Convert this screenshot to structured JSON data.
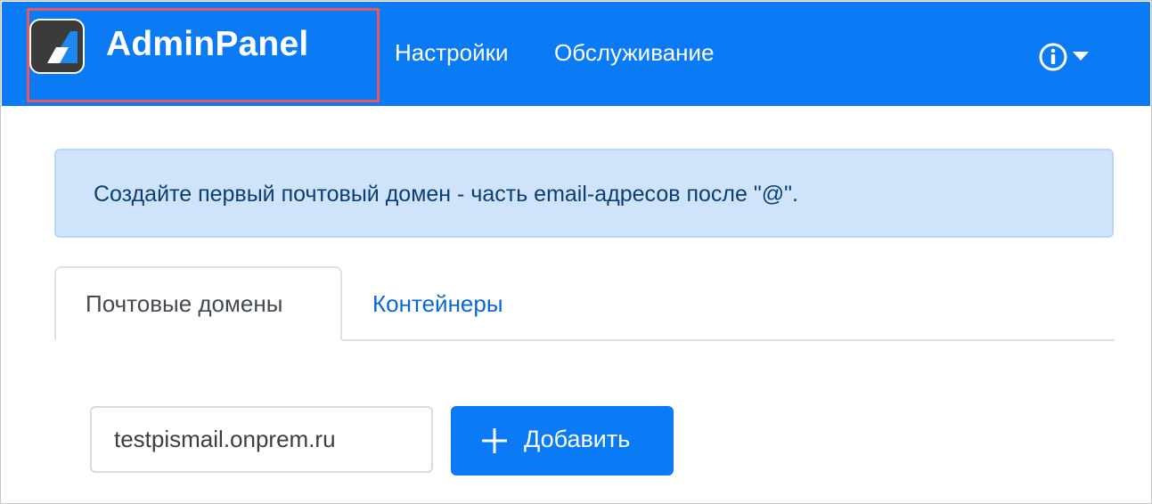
{
  "navbar": {
    "brand": "AdminPanel",
    "links": [
      "Настройки",
      "Обслуживание"
    ],
    "brand_highlight_color": "#e9585e",
    "background_color": "#0a7af5",
    "info_menu_icon": "info-circle-icon"
  },
  "alert": {
    "text": "Создайте первый почтовый домен - часть email-адресов после \"@\"."
  },
  "tabs": [
    {
      "label": "Почтовые домены",
      "active": true
    },
    {
      "label": "Контейнеры",
      "active": false
    }
  ],
  "domain_form": {
    "input_value": "testpismail.onprem.ru",
    "add_button_label": "Добавить",
    "add_button_icon": "plus-icon"
  }
}
